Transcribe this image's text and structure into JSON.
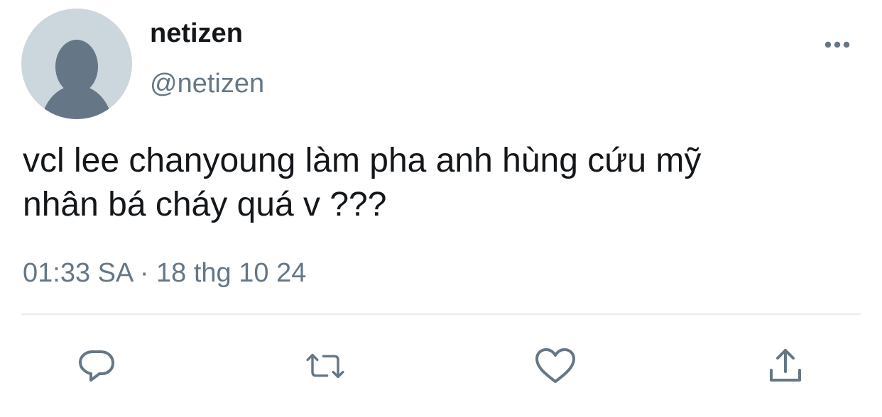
{
  "author": {
    "display_name": "netizen",
    "handle": "@netizen",
    "avatar_icon": "default-avatar-icon"
  },
  "tweet": {
    "text_lines": [
      "vcl lee chanyoung làm pha anh hùng cứu mỹ",
      "nhân bá cháy quá v ???"
    ],
    "time": "01:33 SA",
    "separator": "·",
    "date": "18 thg 10 24"
  },
  "actions": {
    "reply_icon": "reply-icon",
    "retweet_icon": "retweet-icon",
    "like_icon": "heart-icon",
    "share_icon": "share-icon",
    "more_icon": "more-options-icon"
  },
  "colors": {
    "text_primary": "#14171a",
    "text_secondary": "#657786",
    "avatar_bg": "#ccd6dd",
    "avatar_fg": "#657786",
    "divider": "#e6ecf0"
  }
}
